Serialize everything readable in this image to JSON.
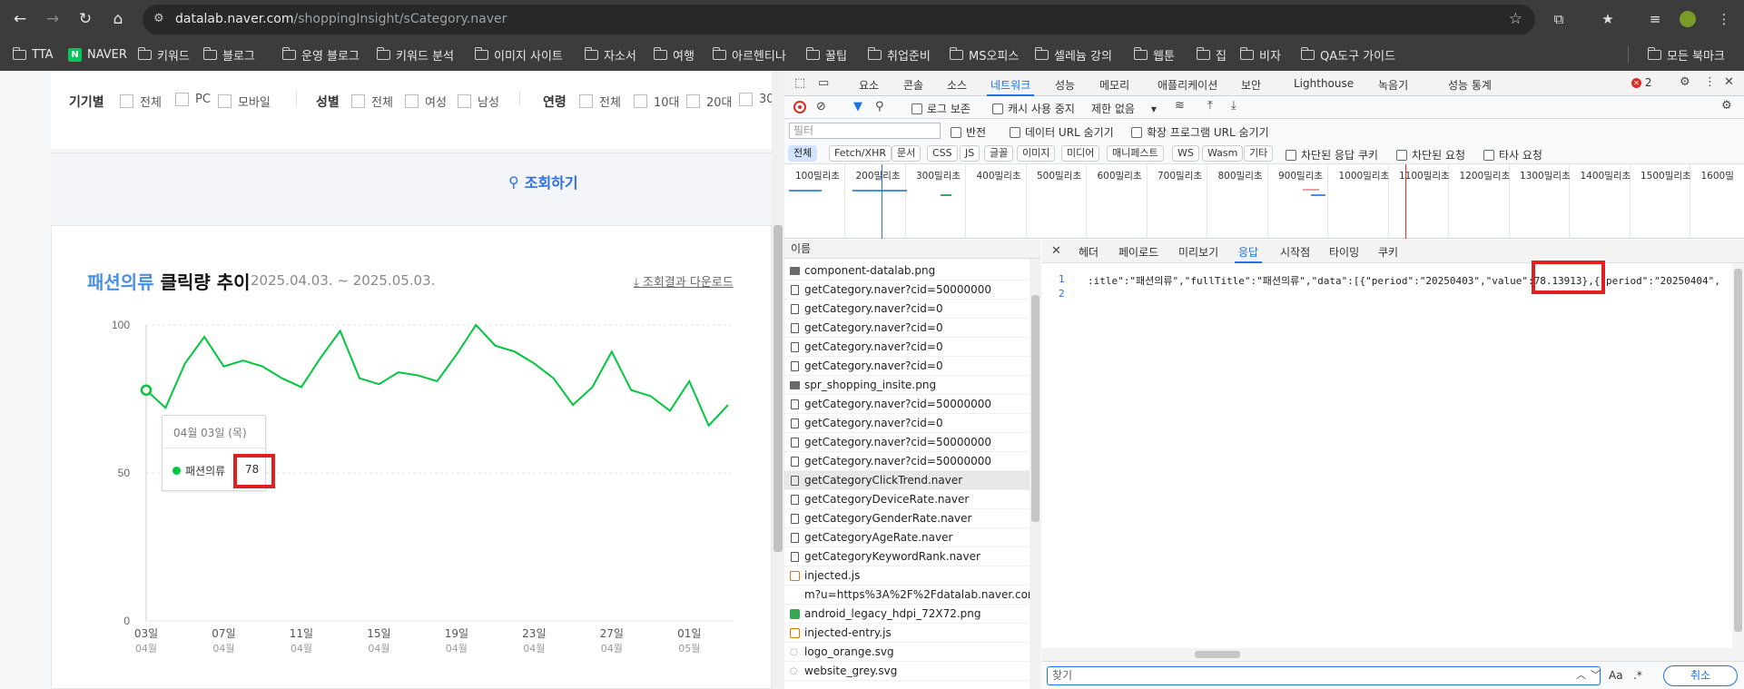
{
  "browser": {
    "url_host": "datalab.naver.com",
    "url_path": "/shoppingInsight/sCategory.naver",
    "bookmarks": [
      "TTA",
      "NAVER",
      "키워드",
      "블로그",
      "운영 블로그",
      "키워드 분석",
      "이미지 사이트",
      "자소서",
      "여행",
      "아르헨티나",
      "꿀팁",
      "취업준비",
      "MS오피스",
      "셀레늄 강의",
      "웹툰",
      "집",
      "비자",
      "QA도구 가이드"
    ],
    "all_bookmarks": "모든 북마크"
  },
  "filters": {
    "device_label": "기기별",
    "device_opts": [
      "전체",
      "PC",
      "모바일"
    ],
    "gender_label": "성별",
    "gender_opts": [
      "전체",
      "여성",
      "남성"
    ],
    "age_label": "연령",
    "age_opts": [
      "전체",
      "10대",
      "20대",
      "30"
    ],
    "search_button": "조회하기"
  },
  "chart_panel": {
    "title_highlight": "패션의류",
    "title_rest": " 클릭량 추이",
    "date_range": "2025.04.03. ~ 2025.05.03.",
    "download": "조회결과 다운로드",
    "tooltip_date": "04월 03일 (목)",
    "tooltip_series": "패션의류",
    "tooltip_value": "78"
  },
  "chart_data": {
    "type": "line",
    "ylim": [
      0,
      100
    ],
    "yticks": [
      "100",
      "50",
      "0"
    ],
    "xtick_days": [
      "03일",
      "07일",
      "11일",
      "15일",
      "19일",
      "23일",
      "27일",
      "01일"
    ],
    "xtick_months": [
      "04월",
      "04월",
      "04월",
      "04월",
      "04월",
      "04월",
      "04월",
      "05월"
    ],
    "series": [
      {
        "name": "패션의류",
        "color": "#00c73c",
        "values": [
          78,
          72,
          87,
          96,
          86,
          88,
          86,
          82,
          79,
          89,
          98,
          82,
          80,
          84,
          83,
          81,
          90,
          100,
          93,
          91,
          87,
          82,
          73,
          79,
          91,
          78,
          76,
          71,
          81,
          66,
          73
        ]
      }
    ]
  },
  "devtools": {
    "tabs": [
      "요소",
      "콘솔",
      "소스",
      "네트워크",
      "성능",
      "메모리",
      "애플리케이션",
      "보안",
      "Lighthouse",
      "녹음기",
      "성능 통계"
    ],
    "error_count": "2",
    "toolbar": {
      "preserve_log": "로그 보존",
      "disable_cache": "캐시 사용 중지",
      "throttle": "제한 없음"
    },
    "filter_placeholder": "필터",
    "invert": "반전",
    "hide_data_urls": "데이터 URL 숨기기",
    "hide_ext_urls": "확장 프로그램 URL 숨기기",
    "type_chips": [
      "전체",
      "Fetch/XHR",
      "문서",
      "CSS",
      "JS",
      "글꼴",
      "이미지",
      "미디어",
      "매니페스트",
      "WS",
      "Wasm",
      "기타"
    ],
    "blocked_cookies": "차단된 응답 쿠키",
    "blocked_requests": "차단된 요청",
    "third_party": "타사 요청",
    "timeline_labels": [
      "100밀리초",
      "200밀리초",
      "300밀리초",
      "400밀리초",
      "500밀리초",
      "600밀리초",
      "700밀리초",
      "800밀리초",
      "900밀리초",
      "1000밀리초",
      "1100밀리초",
      "1200밀리초",
      "1300밀리초",
      "1400밀리초",
      "1500밀리초",
      "1600밀"
    ],
    "name_header": "이름",
    "requests": [
      "component-datalab.png",
      "getCategory.naver?cid=50000000",
      "getCategory.naver?cid=0",
      "getCategory.naver?cid=0",
      "getCategory.naver?cid=0",
      "getCategory.naver?cid=0",
      "spr_shopping_insite.png",
      "getCategory.naver?cid=50000000",
      "getCategory.naver?cid=0",
      "getCategory.naver?cid=50000000",
      "getCategory.naver?cid=50000000",
      "getCategoryClickTrend.naver",
      "getCategoryDeviceRate.naver",
      "getCategoryGenderRate.naver",
      "getCategoryAgeRate.naver",
      "getCategoryKeywordRank.naver",
      "injected.js",
      "m?u=https%3A%2F%2Fdatalab.naver.com...",
      "android_legacy_hdpi_72X72.png",
      "injected-entry.js",
      "logo_orange.svg",
      "website_grey.svg"
    ],
    "detail_tabs": [
      "헤더",
      "페이로드",
      "미리보기",
      "응답",
      "시작점",
      "타이밍",
      "쿠키"
    ],
    "response_line_before": ":itle\":\"패션의류\",\"fullTitle\":\"패션의류\",\"data\":[{\"period\":\"20250403\",\"value",
    "response_value": "\":78.13913}",
    "response_line_after": ",{\"period\":\"20250404\",",
    "line_numbers": [
      "1",
      "2"
    ],
    "find_placeholder": "찾기",
    "match_case": "Aa",
    "regex": ".*",
    "cancel": "취소"
  }
}
